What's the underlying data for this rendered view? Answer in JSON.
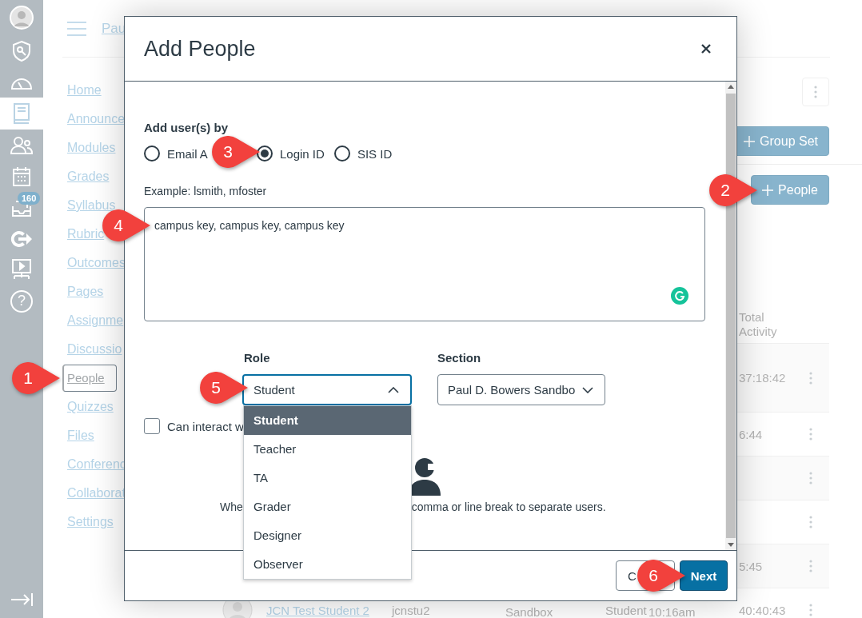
{
  "global_nav": {
    "items": [
      {
        "selected": false
      },
      {
        "selected": false
      },
      {
        "selected": false
      },
      {
        "selected": true
      },
      {
        "selected": false
      },
      {
        "selected": false
      },
      {
        "selected": false,
        "badge": "160"
      },
      {
        "selected": false
      },
      {
        "selected": false
      },
      {
        "selected": false,
        "glyph": "?"
      }
    ]
  },
  "header": {
    "breadcrumb": "Pau"
  },
  "course_nav": [
    {
      "label": "Home",
      "selected": false
    },
    {
      "label": "Announce",
      "selected": false
    },
    {
      "label": "Modules",
      "selected": false
    },
    {
      "label": "Grades",
      "selected": false
    },
    {
      "label": "Syllabus",
      "selected": false
    },
    {
      "label": "Rubric",
      "selected": false
    },
    {
      "label": "Outcomes",
      "selected": false
    },
    {
      "label": "Pages",
      "selected": false
    },
    {
      "label": "Assignme",
      "selected": false
    },
    {
      "label": "Discussio",
      "selected": false
    },
    {
      "label": "People",
      "selected": true
    },
    {
      "label": "Quizzes",
      "selected": false
    },
    {
      "label": "Files",
      "selected": false
    },
    {
      "label": "Conferenc",
      "selected": false
    },
    {
      "label": "Collaborat",
      "selected": false
    },
    {
      "label": "Settings",
      "selected": false
    }
  ],
  "toolbar": {
    "group_set_button": "Group Set",
    "people_button": "People"
  },
  "table": {
    "total_activity_header": "Total Activity",
    "rows": [
      {
        "total_activity": "37:18:42"
      },
      {
        "total_activity": "6:44"
      },
      {},
      {},
      {
        "total_activity": "5:45"
      },
      {
        "name": "JCN Test Student 2",
        "login": "jcnstu2",
        "section": "Sandbox",
        "role": "Student",
        "last_activity": "10:16am",
        "total_activity": "40:40:43"
      }
    ]
  },
  "dialog": {
    "title": "Add People",
    "add_by": {
      "label": "Add user(s) by",
      "options": [
        {
          "label": "Email A",
          "selected": false
        },
        {
          "label": "Login ID",
          "selected": true
        },
        {
          "label": "SIS ID",
          "selected": false
        }
      ]
    },
    "example": "Example: lsmith, mfoster",
    "users_field": {
      "value": "campus key, campus key, campus key"
    },
    "role": {
      "label": "Role",
      "value": "Student",
      "expanded": true,
      "options": [
        {
          "label": "Student",
          "selected": true
        },
        {
          "label": "Teacher",
          "selected": false
        },
        {
          "label": "TA",
          "selected": false
        },
        {
          "label": "Grader",
          "selected": false
        },
        {
          "label": "Designer",
          "selected": false
        },
        {
          "label": "Observer",
          "selected": false
        }
      ]
    },
    "section": {
      "label": "Section",
      "value": "Paul D. Bowers Sandbo"
    },
    "interact_checkbox": {
      "label": "Can interact w",
      "checked": false
    },
    "hint": [
      "Whe",
      "comma or line break to separate users."
    ],
    "buttons": [
      {
        "label": "C",
        "kind": "secondary"
      },
      {
        "label": "Next",
        "kind": "primary"
      }
    ]
  },
  "callouts": [
    {
      "label": "1"
    },
    {
      "label": "2"
    },
    {
      "label": "3"
    },
    {
      "label": "4"
    },
    {
      "label": "5"
    },
    {
      "label": "6"
    }
  ]
}
